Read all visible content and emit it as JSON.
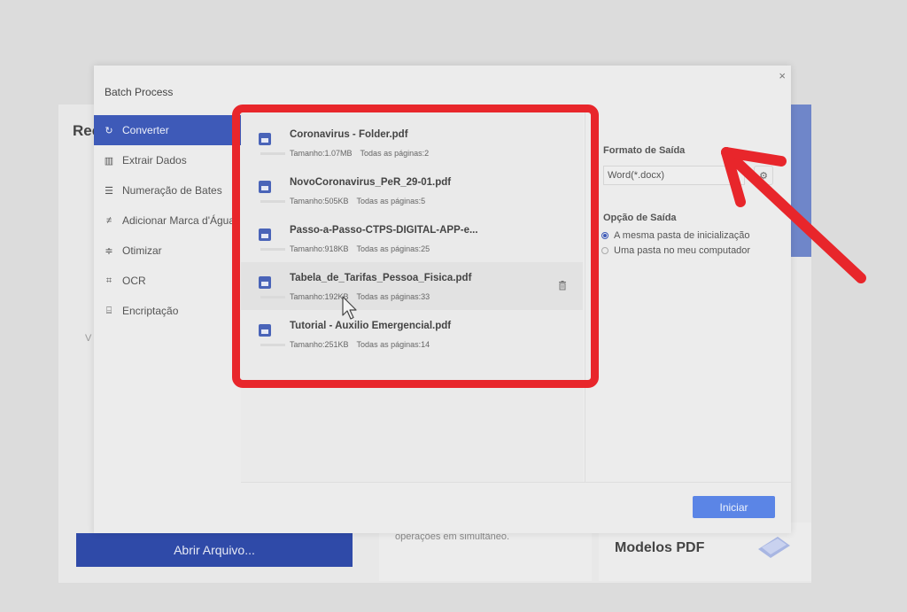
{
  "background": {
    "title": "Rec",
    "side_text": "V",
    "open_button": "Abrir Arquivo...",
    "mid_card_text": "operações em simultâneo.",
    "models_label": "Modelos PDF"
  },
  "dialog": {
    "title": "Batch Process",
    "close_symbol": "×",
    "start_button": "Iniciar"
  },
  "sidebar": {
    "items": [
      {
        "label": "Converter",
        "icon": "refresh-icon",
        "glyph": "↻",
        "active": true
      },
      {
        "label": "Extrair Dados",
        "icon": "chart-icon",
        "glyph": "▥",
        "active": false
      },
      {
        "label": "Numeração de Bates",
        "icon": "numbering-icon",
        "glyph": "☰",
        "active": false
      },
      {
        "label": "Adicionar Marca d'Água",
        "icon": "watermark-icon",
        "glyph": "≠",
        "active": false
      },
      {
        "label": "Otimizar",
        "icon": "optimize-icon",
        "glyph": "≑",
        "active": false
      },
      {
        "label": "OCR",
        "icon": "ocr-icon",
        "glyph": "⌗",
        "active": false
      },
      {
        "label": "Encriptação",
        "icon": "lock-icon",
        "glyph": "⌸",
        "active": false
      }
    ]
  },
  "files": [
    {
      "name": "Coronavirus - Folder.pdf",
      "size": "Tamanho:1.07MB",
      "pages": "Todas as páginas:2"
    },
    {
      "name": "NovoCoronavirus_PeR_29-01.pdf",
      "size": "Tamanho:505KB",
      "pages": "Todas as páginas:5"
    },
    {
      "name": "Passo-a-Passo-CTPS-DIGITAL-APP-e...",
      "size": "Tamanho:918KB",
      "pages": "Todas as páginas:25"
    },
    {
      "name": "Tabela_de_Tarifas_Pessoa_Fisica.pdf",
      "size": "Tamanho:192KB",
      "pages": "Todas as páginas:33"
    },
    {
      "name": "Tutorial - Auxilio Emergencial.pdf",
      "size": "Tamanho:251KB",
      "pages": "Todas as páginas:14"
    }
  ],
  "output": {
    "format_label": "Formato de Saída",
    "format_value": "Word(*.docx)",
    "option_label": "Opção de Saída",
    "options": [
      {
        "label": "A mesma pasta de inicialização",
        "selected": true
      },
      {
        "label": "Uma pasta no meu computador",
        "selected": false
      }
    ]
  },
  "colors": {
    "accent": "#3e5ab8",
    "start_button": "#5b85e6",
    "annotation": "#e8262b"
  }
}
